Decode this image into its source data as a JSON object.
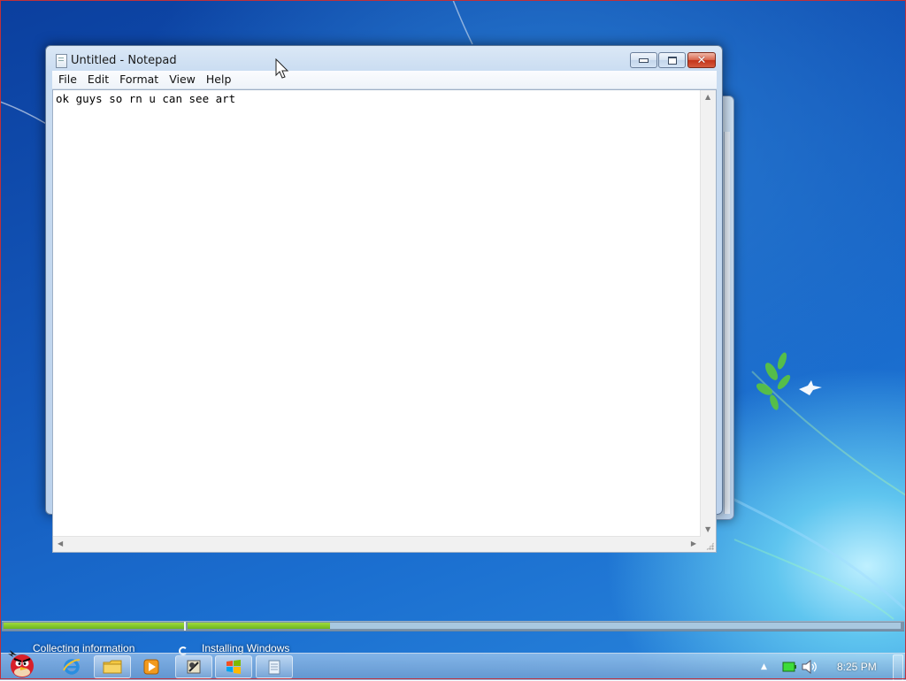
{
  "notepad": {
    "title": "Untitled - Notepad",
    "menu": [
      "File",
      "Edit",
      "Format",
      "View",
      "Help"
    ],
    "content": "ok guys so rn u can see art"
  },
  "setup": {
    "stages": [
      "Collecting information",
      "Installing Windows"
    ],
    "collecting_progress": 1.0,
    "installing_progress": 0.2
  },
  "taskbar": {
    "items": [
      "angry-bird-icon",
      "internet-explorer-icon",
      "folder-icon",
      "media-player-icon",
      "app-icon",
      "windows-logo-icon",
      "notepad-icon"
    ],
    "clock": "8:25 PM",
    "tray": [
      "show-hidden-icons-chevron",
      "battery-icon",
      "volume-icon"
    ]
  },
  "colors": {
    "progress_green": "#7cc428",
    "close_button_red": "#c4341a",
    "desktop_blue": "#1458bb",
    "frame_border": "#c0303a"
  }
}
